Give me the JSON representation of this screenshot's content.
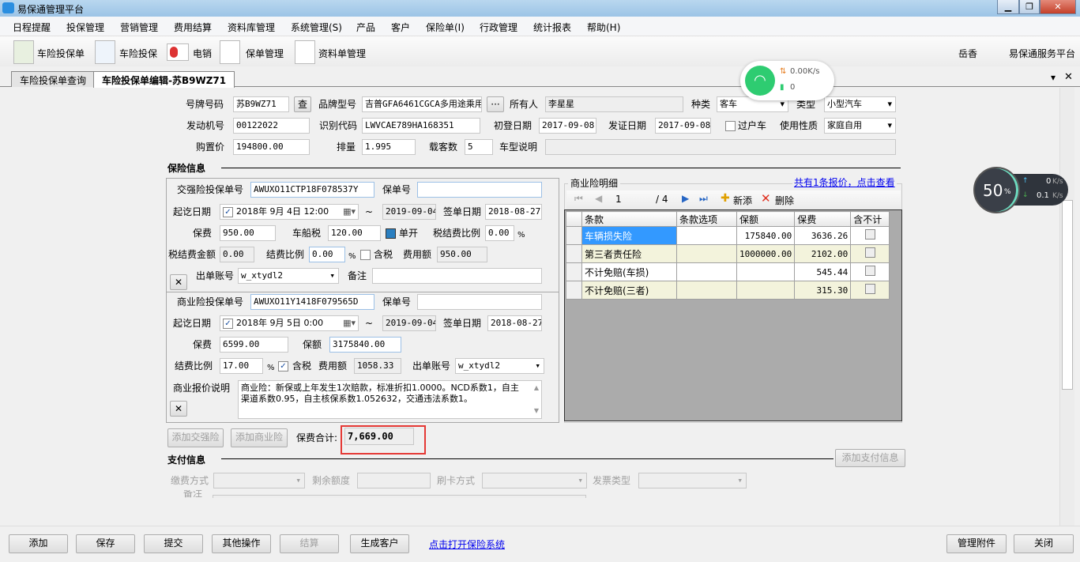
{
  "window": {
    "title": "易保通管理平台",
    "min": "▁",
    "restore": "❐",
    "close": "✕"
  },
  "menu": [
    "日程提醒",
    "投保管理",
    "营销管理",
    "费用结算",
    "资料库管理",
    "系统管理(S)",
    "产品",
    "客户",
    "保险单(I)",
    "行政管理",
    "统计报表",
    "帮助(H)"
  ],
  "toolbar": {
    "items": [
      "车险投保单",
      "车险投保",
      "电销",
      "保单管理",
      "资料单管理"
    ],
    "user": "岳香",
    "platform": "易保通服务平台"
  },
  "tabs": [
    "车险投保单查询",
    "车险投保单编辑-苏B9WZ71"
  ],
  "tab_controls": {
    "dropdown": "▾",
    "close": "✕"
  },
  "vehicle": {
    "plate_label": "号牌号码",
    "plate": "苏B9WZ71",
    "lookup_btn": "查",
    "brand_label": "品牌型号",
    "brand": "吉普GFA6461CGCA多用途乘用",
    "more_btn": "···",
    "owner_label": "所有人",
    "owner": "李星星",
    "kind_label": "种类",
    "kind": "客车",
    "type_label": "类型",
    "type": "小型汽车",
    "engine_label": "发动机号",
    "engine": "00122022",
    "vin_label": "识别代码",
    "vin": "LWVCAE789HA168351",
    "reg_label": "初登日期",
    "reg_date": "2017-09-08",
    "issue_label": "发证日期",
    "issue_date": "2017-09-08",
    "transfer_label": "过户车",
    "usage_label": "使用性质",
    "usage": "家庭自用",
    "price_label": "购置价",
    "price": "194800.00",
    "disp_label": "排量",
    "displacement": "1.995",
    "seats_label": "载客数",
    "seats": "5",
    "model_desc_label": "车型说明",
    "model_desc": ""
  },
  "insurance_header": "保险信息",
  "compulsory": {
    "no_label": "交强险投保单号",
    "no": "AWUXO11CTP18F078537Y",
    "policy_label": "保单号",
    "policy": "",
    "period_label": "起讫日期",
    "start": "2018年  9月  4日  12:00",
    "tilde": "~",
    "end": "2019-09-04",
    "sign_label": "签单日期",
    "sign": "2018-08-27",
    "premium_label": "保费",
    "premium": "950.00",
    "tax_label": "车船税",
    "tax": "120.00",
    "separate_label": "单开",
    "tax_ratio_label": "税结费比例",
    "tax_ratio": "0.00",
    "pct": "%",
    "tax_amount_label": "税结费金额",
    "tax_amount": "0.00",
    "ratio_label": "结费比例",
    "ratio": "0.00",
    "incl_tax_label": "含税",
    "fee_label": "费用额",
    "fee": "950.00",
    "account_label": "出单账号",
    "account": "w_xtydl2",
    "remark_label": "备注",
    "remark": "",
    "remove": "✕"
  },
  "commercial": {
    "no_label": "商业险投保单号",
    "no": "AWUXO11Y1418F079565D",
    "policy_label": "保单号",
    "policy": "",
    "period_label": "起讫日期",
    "start": "2018年  9月  5日    0:00",
    "tilde": "~",
    "end": "2019-09-04",
    "sign_label": "签单日期",
    "sign": "2018-08-27",
    "premium_label": "保费",
    "premium": "6599.00",
    "amount_label": "保额",
    "amount": "3175840.00",
    "ratio_label": "结费比例",
    "ratio": "17.00",
    "pct": "%",
    "incl_tax_label": "含税",
    "fee_label": "费用额",
    "fee": "1058.33",
    "account_label": "出单账号",
    "account": "w_xtydl2",
    "desc_label": "商业报价说明",
    "desc": "商业险：新保或上年发生1次赔款，标准折扣1.0000。NCD系数1，自主渠道系数0.95，自主核保系数1.052632，交通违法系数1。",
    "remove": "✕"
  },
  "detail": {
    "title": "商业险明细",
    "link": "共有1条报价，点击查看",
    "page": "1",
    "pages": "/ 4",
    "add": "新添",
    "delete": "删除",
    "columns": [
      "条款",
      "条款选项",
      "保额",
      "保费",
      "含不计"
    ],
    "rows": [
      {
        "item": "车辆损失险",
        "option": "",
        "amount": "175840.00",
        "premium": "3636.26"
      },
      {
        "item": "第三者责任险",
        "option": "",
        "amount": "1000000.00",
        "premium": "2102.00"
      },
      {
        "item": "不计免赔(车损)",
        "option": "",
        "amount": "",
        "premium": "545.44"
      },
      {
        "item": "不计免赔(三者)",
        "option": "",
        "amount": "",
        "premium": "315.30"
      }
    ]
  },
  "actions": {
    "add_compulsory": "添加交强险",
    "add_commercial": "添加商业险",
    "total_label": "保费合计:",
    "total": "7,669.00"
  },
  "payment": {
    "header": "支付信息",
    "add": "添加支付信息",
    "method_label": "缴费方式",
    "balance_label": "剩余额度",
    "card_label": "刷卡方式",
    "invoice_label": "发票类型",
    "remark_label": "备注"
  },
  "bottom": {
    "add": "添加",
    "save": "保存",
    "submit": "提交",
    "other": "其他操作",
    "settle": "结算",
    "gen_customer": "生成客户",
    "open_link": "点击打开保险系统",
    "attachments": "管理附件",
    "close": "关闭"
  },
  "net_widget": {
    "speed": "0.00K/s",
    "count": "0"
  },
  "meter_widget": {
    "percent": "50",
    "pct_sign": "%",
    "up": "0",
    "down": "0.1",
    "unit": "K/s"
  },
  "colors": {
    "highlight": "#3399ff",
    "total_border": "#e53935",
    "wifi": "#2ecc71",
    "alt_row": "#f3f3dc"
  }
}
